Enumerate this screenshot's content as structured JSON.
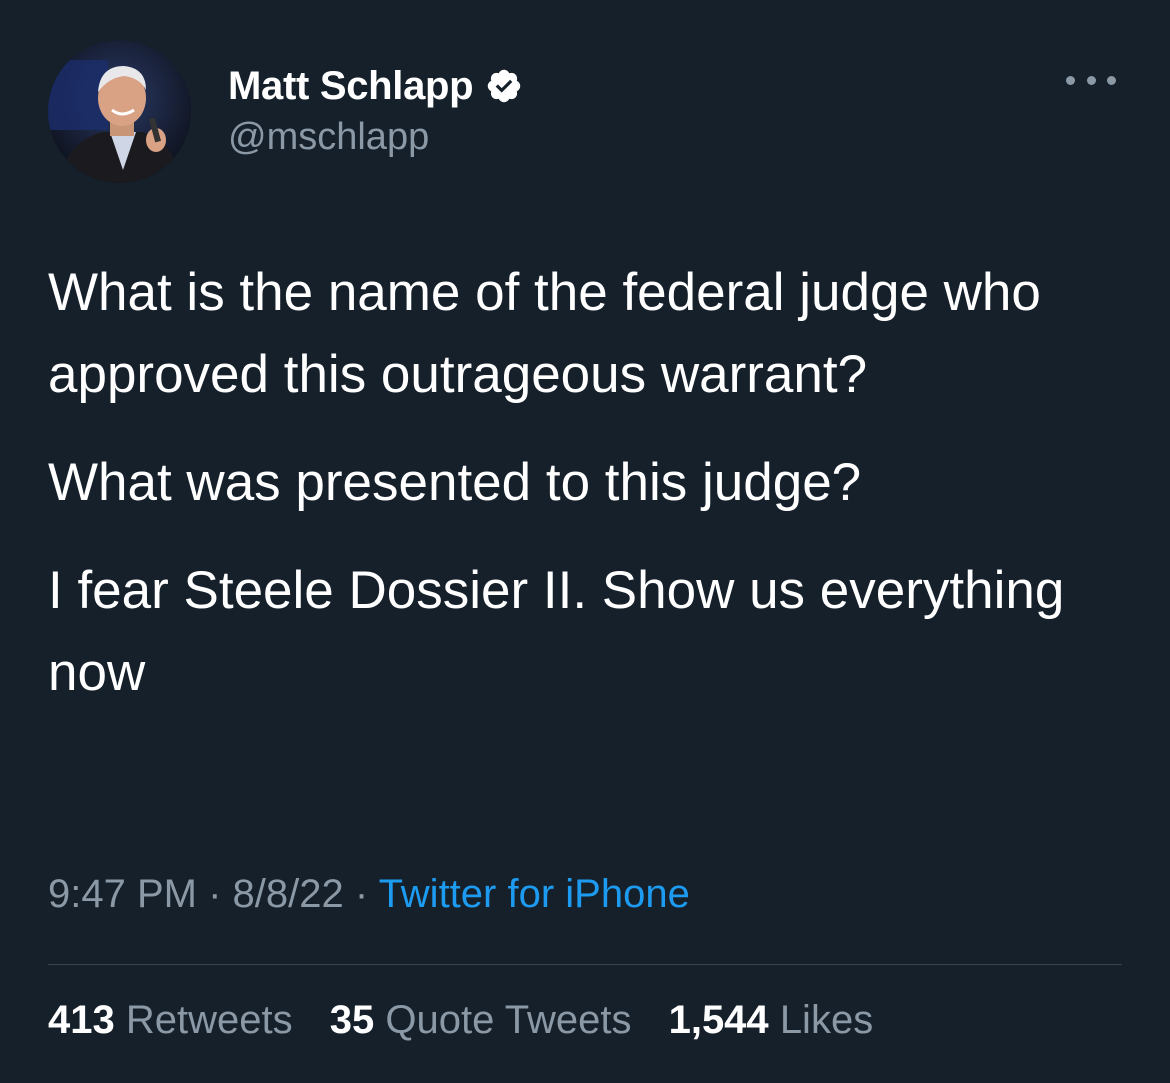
{
  "author": {
    "display_name": "Matt Schlapp",
    "handle": "@mschlapp",
    "verified": true,
    "avatar_icon": "profile-photo"
  },
  "tweet": {
    "paragraphs": [
      "What is the name of the federal judge who approved this outrageous warrant?",
      "What was presented to this judge?",
      "I fear Steele Dossier II. Show us everything now"
    ]
  },
  "meta": {
    "time": "9:47 PM",
    "separator": " · ",
    "date": "8/8/22",
    "source": "Twitter for iPhone"
  },
  "stats": {
    "retweets_count": "413",
    "retweets_label": "Retweets",
    "quote_count": "35",
    "quote_label": "Quote Tweets",
    "likes_count": "1,544",
    "likes_label": "Likes"
  },
  "colors": {
    "background": "#15202b",
    "text": "#ffffff",
    "secondary": "#8b98a5",
    "link": "#1d9bf0",
    "divider": "#38444d"
  }
}
